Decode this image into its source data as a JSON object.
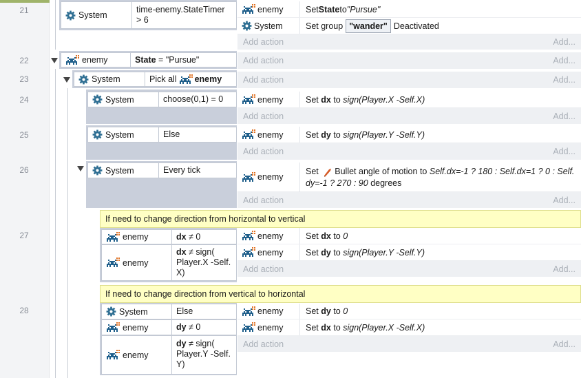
{
  "rows": [
    "21",
    "22",
    "23",
    "24",
    "25",
    "26",
    "27",
    "28"
  ],
  "obj": {
    "system": "System",
    "enemy": "enemy"
  },
  "e21": {
    "cond": "time-enemy.StateTimer > 6",
    "a1_pre": "Set ",
    "a1_b": "State",
    "a1_mid": " to ",
    "a1_i": "\"Pursue\"",
    "a2_pre": "Set group",
    "a2_tag": "\"wander\"",
    "a2_post": "Deactivated"
  },
  "e22": {
    "cond_b": "State",
    "cond_rest": " = \"Pursue\""
  },
  "e23": {
    "cond_pre": "Pick all"
  },
  "e24": {
    "cond": "choose(0,1) = 0",
    "a_pre": "Set ",
    "a_b": "dx",
    "a_mid": " to ",
    "a_i": "sign(Player.X -Self.X)"
  },
  "e25": {
    "cond": "Else",
    "a_pre": "Set ",
    "a_b": "dy",
    "a_mid": " to ",
    "a_i": "sign(Player.Y -Self.Y)"
  },
  "e26": {
    "cond": "Every tick",
    "a_pre": "Set",
    "a_name": "Bullet angle of motion to",
    "a_i1": "Self.dx=-1 ? 180 : Self.dx=1 ? 0 : Self.",
    "a_i2": "dy=-1 ? 270 : 90",
    "a_post": "degrees"
  },
  "comment27": "If need to change direction from horizontal to vertical",
  "e27": {
    "c1_b": "dx",
    "c1_rest": " ≠ 0",
    "c2_b": "dx",
    "c2_l1": " ≠ sign(",
    "c2_l2": "Player.X -Self.",
    "c2_l3": "X)",
    "a1_pre": "Set ",
    "a1_b": "dx",
    "a1_mid": " to ",
    "a1_i": "0",
    "a2_pre": "Set ",
    "a2_b": "dy",
    "a2_mid": " to ",
    "a2_i": "sign(Player.Y -Self.Y)"
  },
  "comment28": "If need to change direction from vertical to horizontal",
  "e28": {
    "c1": "Else",
    "c2_b": "dy",
    "c2_rest": " ≠ 0",
    "c3_b": "dy",
    "c3_l1": " ≠ sign(",
    "c3_l2": "Player.Y -Self.",
    "c3_l3": "Y)",
    "a1_pre": "Set ",
    "a1_b": "dy",
    "a1_mid": " to ",
    "a1_i": "0",
    "a2_pre": "Set ",
    "a2_b": "dx",
    "a2_mid": " to ",
    "a2_i": "sign(Player.X -Self.X)"
  },
  "add_action": "Add action",
  "add_more": "Add...",
  "icons": {
    "system": "gear-icon",
    "enemy": "space-invader-icon",
    "bullet": "bullet-behavior-icon"
  },
  "colors": {
    "accent": "#1f6f9a",
    "enemy": "#1f5f8b",
    "comment_bg": "#ffffc4",
    "event_bg": "#c9cfdb"
  }
}
